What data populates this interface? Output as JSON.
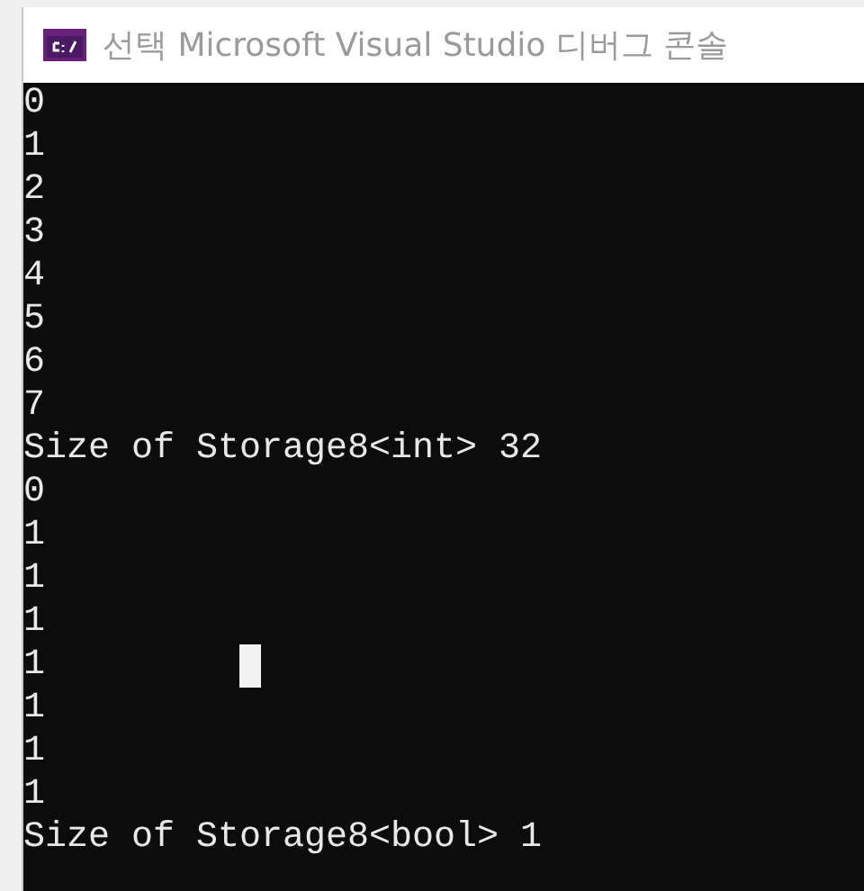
{
  "window": {
    "title": "선택 Microsoft Visual Studio 디버그 콘솔"
  },
  "console": {
    "lines": [
      "0",
      "1",
      "2",
      "3",
      "4",
      "5",
      "6",
      "7",
      "Size of Storage8<int> 32",
      "0",
      "1",
      "1",
      "1",
      "1",
      "1",
      "1",
      "1",
      "Size of Storage8<bool> 1"
    ]
  }
}
